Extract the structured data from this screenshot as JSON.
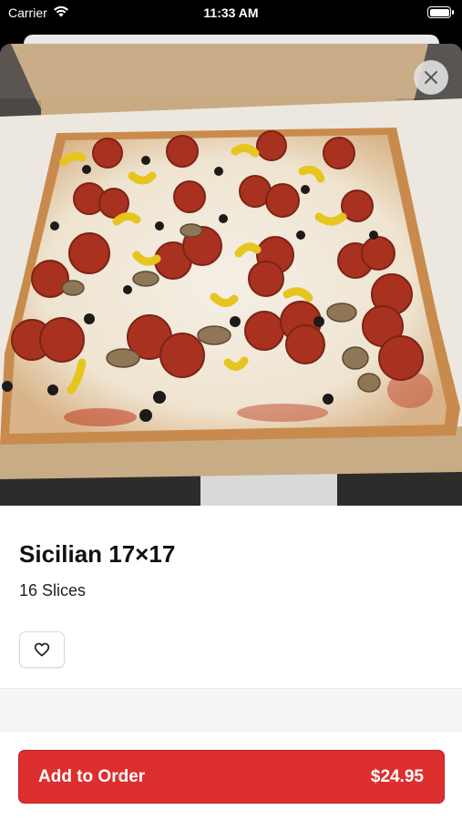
{
  "status_bar": {
    "carrier": "Carrier",
    "time": "11:33 AM",
    "battery_level": 1.0
  },
  "icons": {
    "wifi": "wifi-icon",
    "battery": "battery-icon",
    "close": "close-icon",
    "favorite": "heart-outline-icon"
  },
  "item": {
    "title": "Sicilian 17×17",
    "subtitle": "16 Slices"
  },
  "order": {
    "add_label": "Add to Order",
    "price": "$24.95"
  },
  "colors": {
    "accent": "#dc2f2e",
    "background": "#ffffff"
  }
}
